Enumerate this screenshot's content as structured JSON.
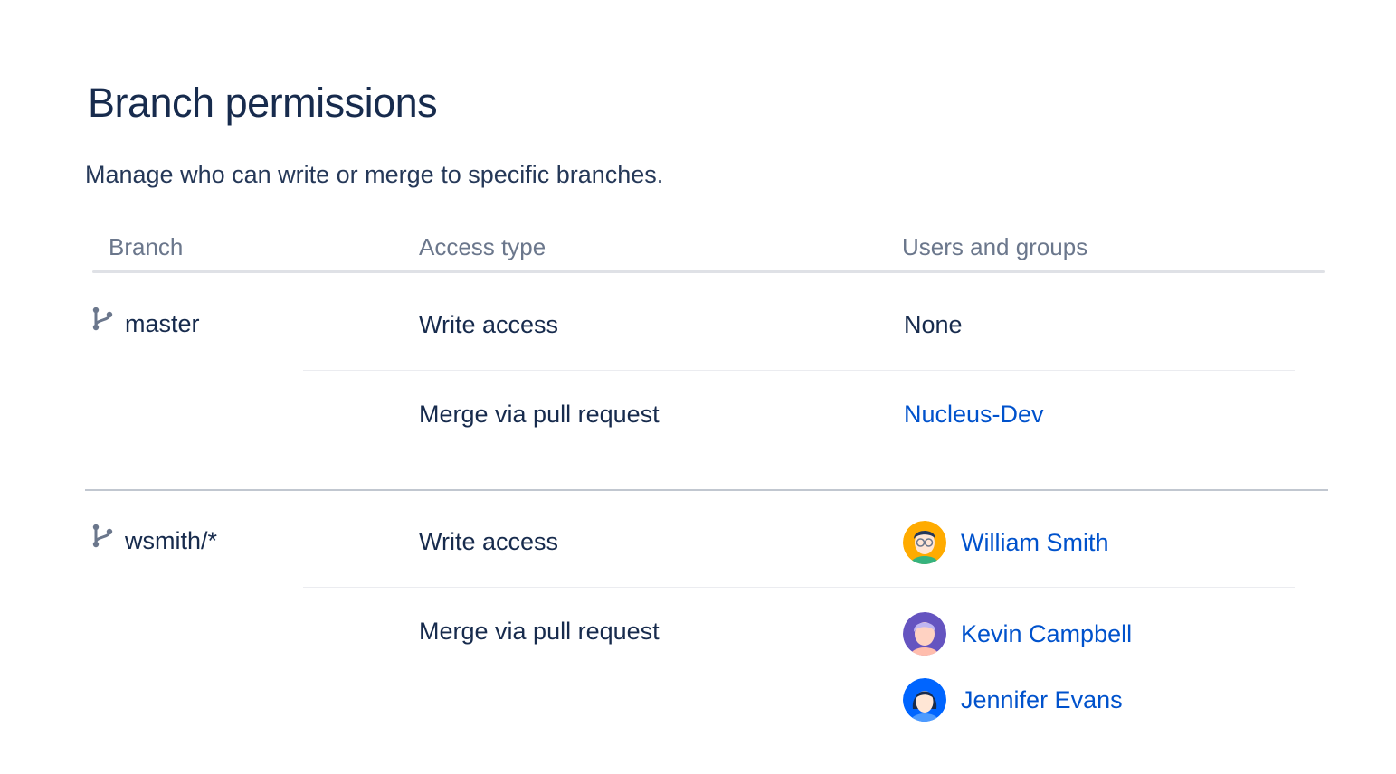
{
  "page": {
    "title": "Branch permissions",
    "description": "Manage who can write or merge to specific branches."
  },
  "table": {
    "columns": [
      "Branch",
      "Access type",
      "Users and groups"
    ],
    "groups": [
      {
        "branch": "master",
        "rows": [
          {
            "access": "Write access",
            "users_text": "None"
          },
          {
            "access": "Merge via pull request",
            "group": "Nucleus-Dev"
          }
        ]
      },
      {
        "branch": "wsmith/*",
        "rows": [
          {
            "access": "Write access",
            "users": [
              {
                "name": "William Smith",
                "avatar_color": "#ffab00"
              }
            ]
          },
          {
            "access": "Merge via pull request",
            "users": [
              {
                "name": "Kevin Campbell",
                "avatar_color": "#6554c0"
              },
              {
                "name": "Jennifer Evans",
                "avatar_color": "#0065ff"
              }
            ]
          }
        ]
      }
    ]
  },
  "colors": {
    "text": "#172b4d",
    "muted": "#6b778c",
    "link": "#0052cc"
  }
}
